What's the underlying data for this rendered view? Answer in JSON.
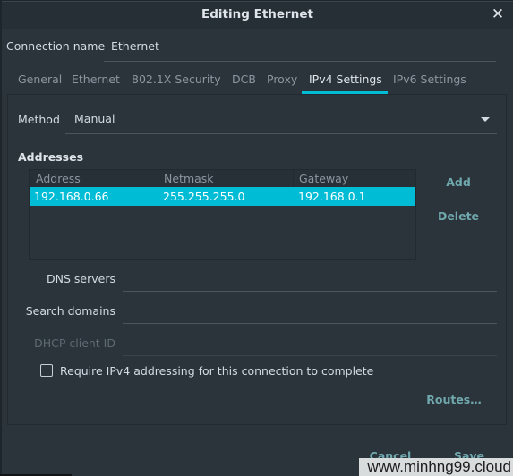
{
  "window": {
    "title": "Editing Ethernet",
    "close_icon": "close-icon"
  },
  "connection": {
    "label": "Connection name",
    "value": "Ethernet"
  },
  "tabs": [
    {
      "label": "General",
      "active": false
    },
    {
      "label": "Ethernet",
      "active": false
    },
    {
      "label": "802.1X Security",
      "active": false
    },
    {
      "label": "DCB",
      "active": false
    },
    {
      "label": "Proxy",
      "active": false
    },
    {
      "label": "IPv4 Settings",
      "active": true
    },
    {
      "label": "IPv6 Settings",
      "active": false
    }
  ],
  "accent_color": "#00bcd4",
  "method": {
    "label": "Method",
    "value": "Manual"
  },
  "addresses": {
    "heading": "Addresses",
    "columns": [
      "Address",
      "Netmask",
      "Gateway"
    ],
    "rows": [
      {
        "address": "192.168.0.66",
        "netmask": "255.255.255.0",
        "gateway": "192.168.0.1",
        "selected": true
      }
    ],
    "add_label": "Add",
    "delete_label": "Delete"
  },
  "fields": {
    "dns_label": "DNS servers",
    "dns_value": "",
    "search_label": "Search domains",
    "search_value": "",
    "dhcp_label": "DHCP client ID",
    "dhcp_value": ""
  },
  "require_checkbox": {
    "label": "Require IPv4 addressing for this connection to complete",
    "checked": false
  },
  "routes_label": "Routes…",
  "footer": {
    "cancel_label": "Cancel",
    "save_label": "Save"
  },
  "watermark": "www.minhng99.cloud"
}
